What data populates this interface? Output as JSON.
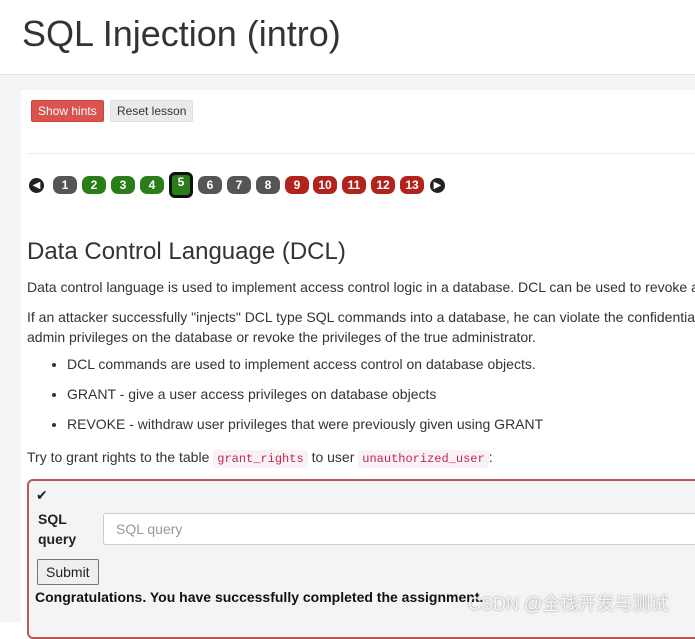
{
  "header": {
    "title": "SQL Injection (intro)"
  },
  "toolbar": {
    "show_hints": "Show hints",
    "reset_lesson": "Reset lesson"
  },
  "pager": {
    "prev_icon": "arrow-left-circle",
    "next_icon": "arrow-right-circle",
    "pages": [
      {
        "label": "1",
        "status": "gray"
      },
      {
        "label": "2",
        "status": "green"
      },
      {
        "label": "3",
        "status": "green"
      },
      {
        "label": "4",
        "status": "green"
      },
      {
        "label": "5",
        "status": "active"
      },
      {
        "label": "6",
        "status": "gray"
      },
      {
        "label": "7",
        "status": "gray"
      },
      {
        "label": "8",
        "status": "gray"
      },
      {
        "label": "9",
        "status": "red"
      },
      {
        "label": "10",
        "status": "red"
      },
      {
        "label": "11",
        "status": "red"
      },
      {
        "label": "12",
        "status": "red"
      },
      {
        "label": "13",
        "status": "red"
      }
    ]
  },
  "content": {
    "heading": "Data Control Language (DCL)",
    "para1": "Data control language is used to implement access control logic in a database. DCL can be used to revoke a",
    "para2_line1": "If an attacker successfully \"injects\" DCL type SQL commands into a database, he can violate the confidentia",
    "para2_line2": "admin privileges on the database or revoke the privileges of the true administrator.",
    "bullets": [
      "DCL commands are used to implement access control on database objects.",
      "GRANT - give a user access privileges on database objects",
      "REVOKE - withdraw user privileges that were previously given using GRANT"
    ],
    "task_prefix": "Try to grant rights to the table",
    "task_table": "grant_rights",
    "task_mid": "to user",
    "task_user": "unauthorized_user",
    "task_suffix": ":"
  },
  "assignment": {
    "check_icon": "✔",
    "sql_label": "SQL query",
    "sql_placeholder": "SQL query",
    "submit_label": "Submit",
    "feedback": "Congratulations. You have successfully completed the assignment."
  },
  "watermark": "CSDN @全栈开发与测试",
  "colors": {
    "hint_red": "#d9534f",
    "page_green": "#2b7d1a",
    "page_red": "#b3231d",
    "page_gray": "#555555",
    "assignment_border": "#b55a5a"
  }
}
